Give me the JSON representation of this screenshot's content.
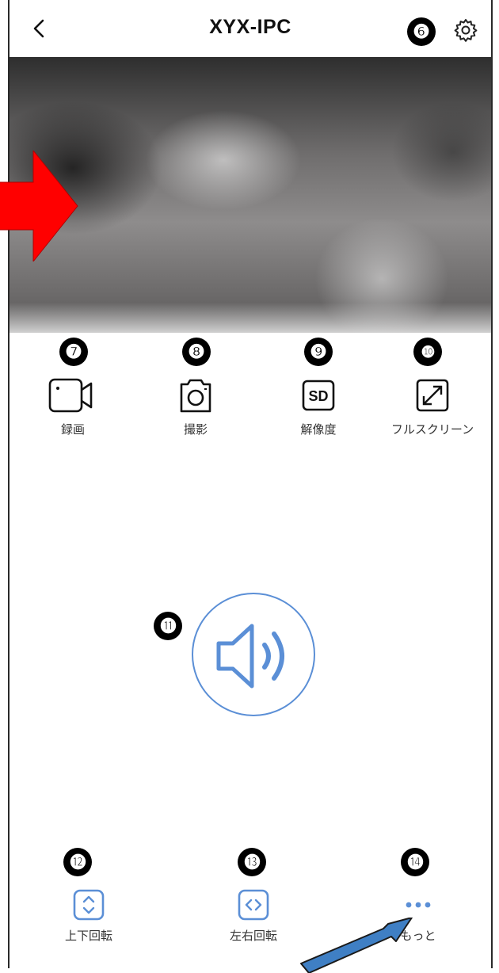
{
  "header": {
    "title": "XYX-IPC",
    "back_icon": "chevron-left-icon",
    "settings_icon": "gear-icon"
  },
  "badges": {
    "settings": "❻",
    "record": "❼",
    "snapshot": "❽",
    "resolution": "❾",
    "fullscreen": "❿",
    "audio": "⓫",
    "vertical_rotate": "⓬",
    "horizontal_rotate": "⓭",
    "more": "⓮"
  },
  "controls": {
    "record": {
      "label": "録画",
      "icon": "video-camera-icon"
    },
    "snapshot": {
      "label": "撮影",
      "icon": "camera-icon"
    },
    "resolution": {
      "label": "解像度",
      "icon": "sd-icon",
      "icon_text": "SD"
    },
    "fullscreen": {
      "label": "フルスクリーン",
      "icon": "expand-icon"
    }
  },
  "audio": {
    "icon": "speaker-icon"
  },
  "bottom": {
    "vertical_rotate": {
      "label": "上下回転",
      "icon": "vertical-flip-icon"
    },
    "horizontal_rotate": {
      "label": "左右回転",
      "icon": "horizontal-flip-icon"
    },
    "more": {
      "label": "もっと",
      "icon": "more-dots-icon"
    }
  },
  "colors": {
    "accent_blue": "#5b8fd6",
    "annotation_red": "#ff0000",
    "annotation_blue": "#3f7fc4"
  }
}
